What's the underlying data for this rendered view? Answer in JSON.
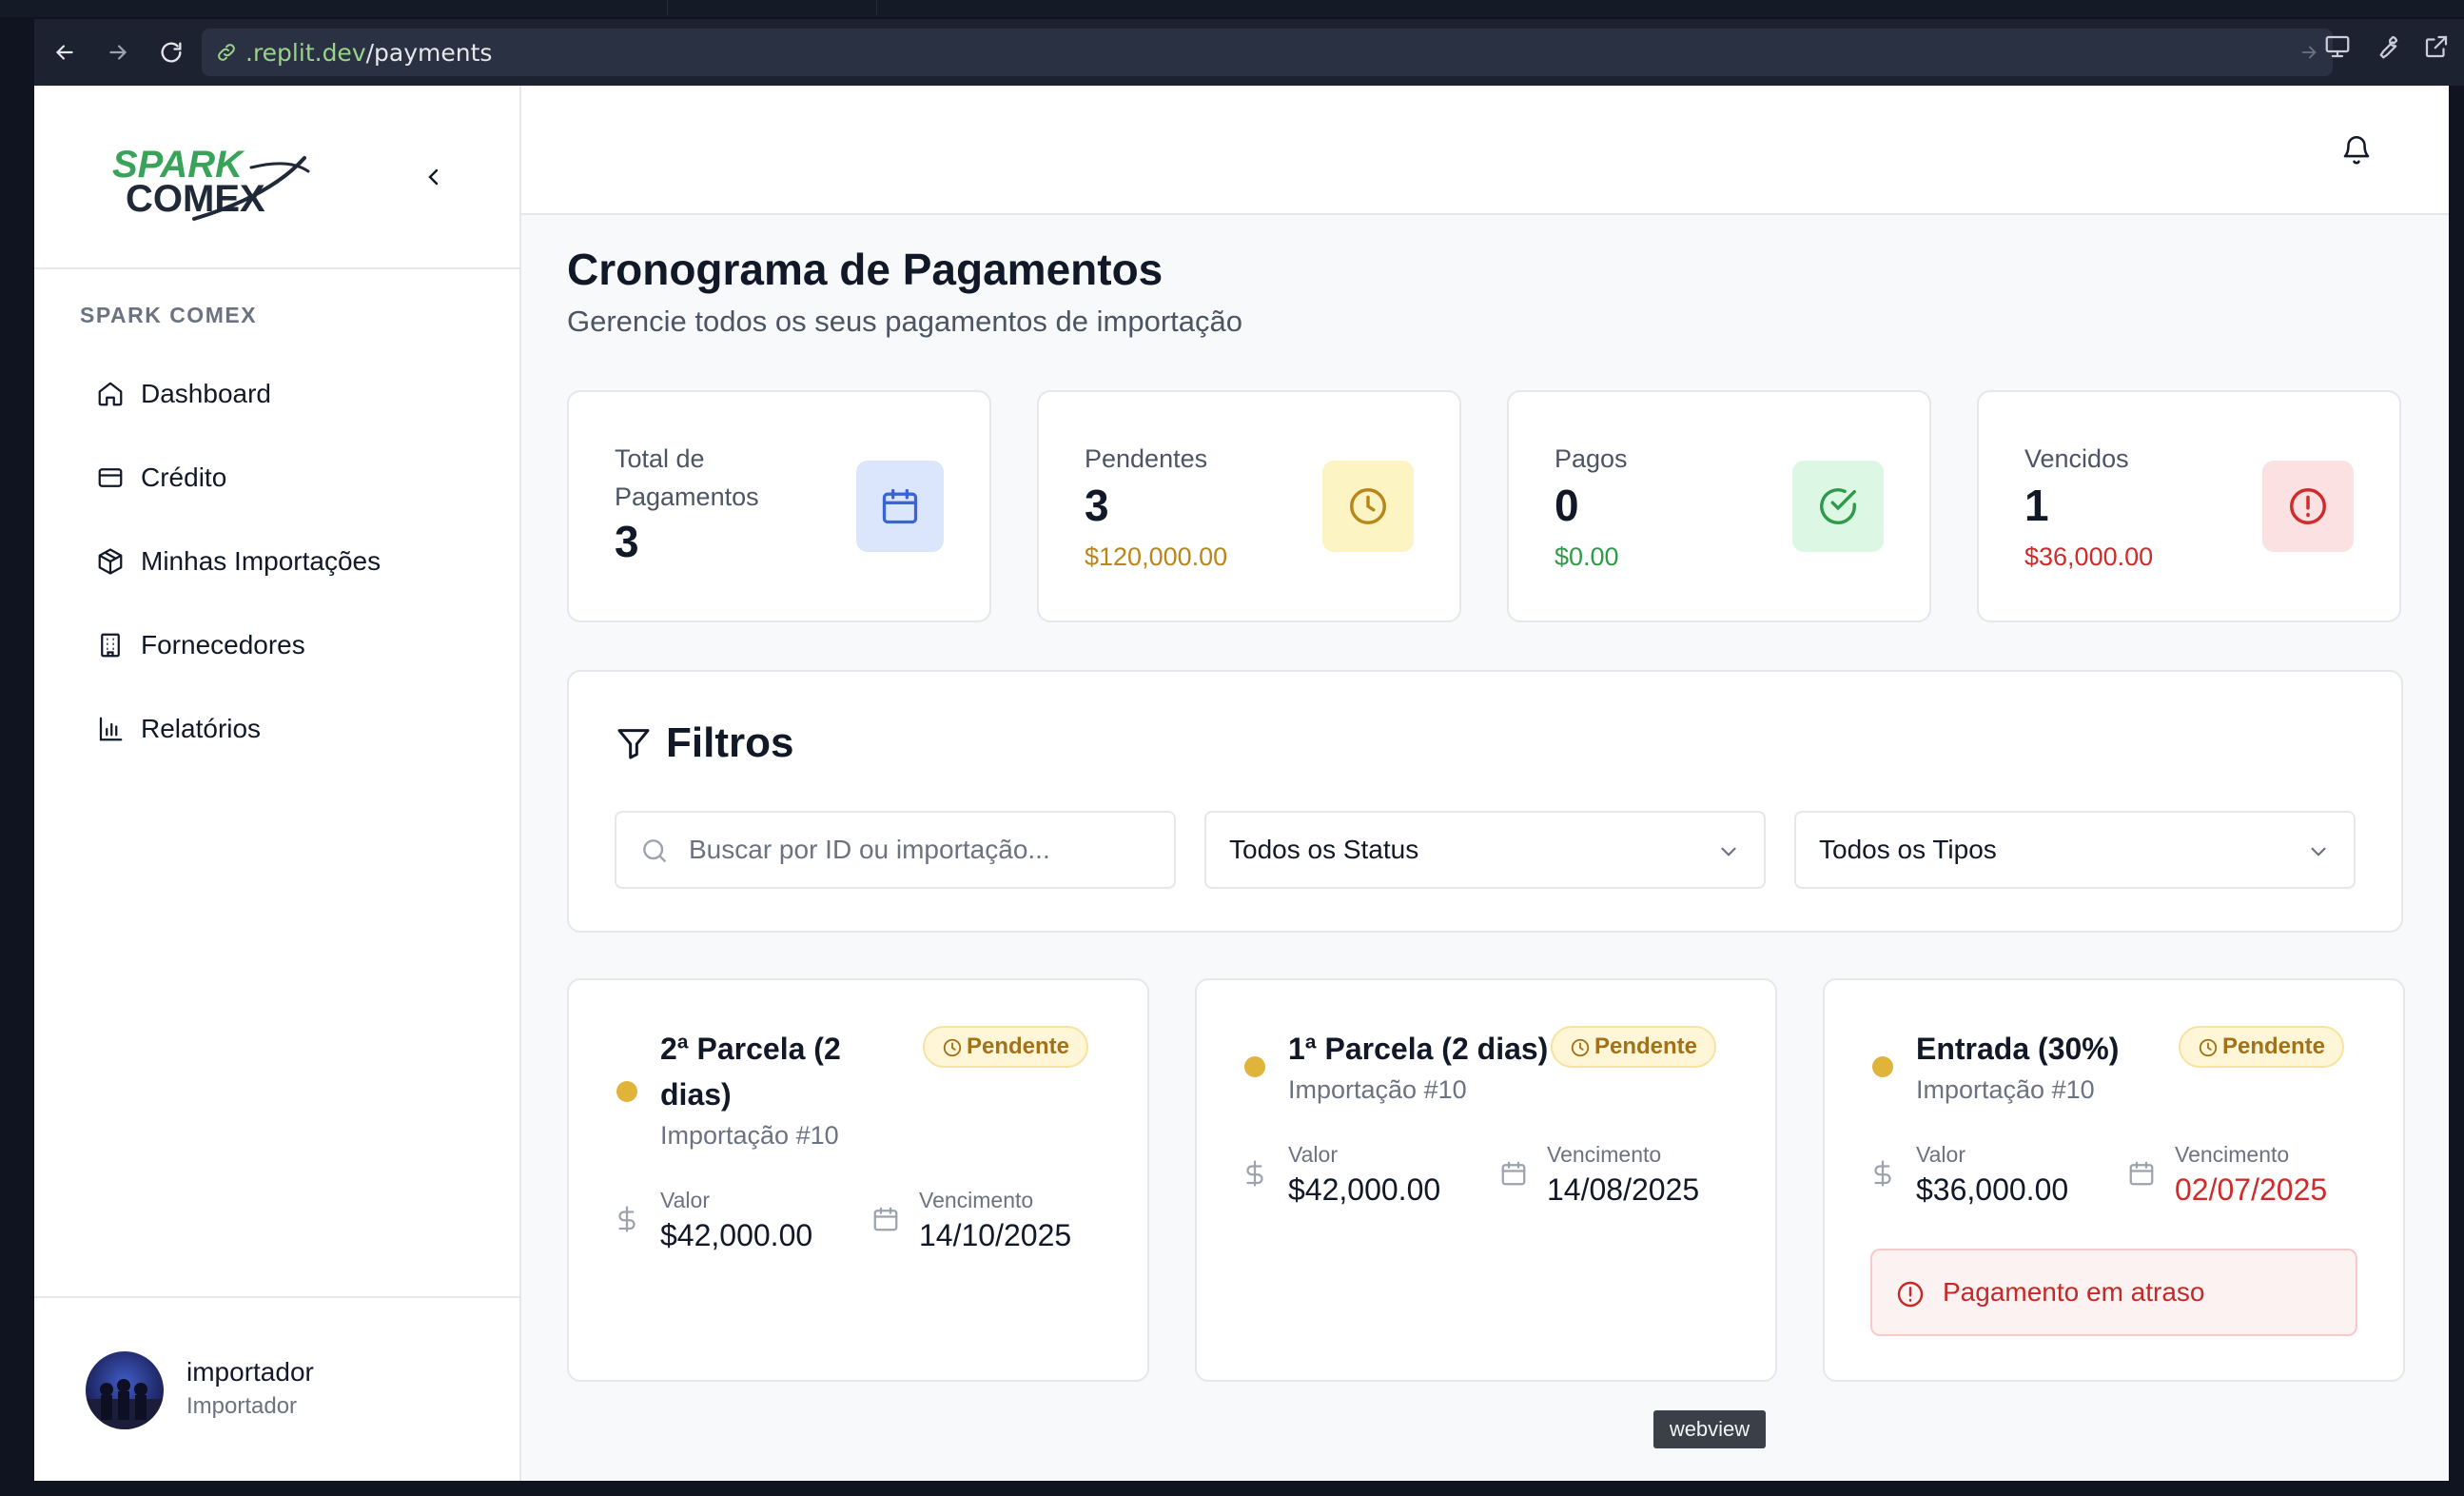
{
  "browser": {
    "url_prefix": ".replit.dev",
    "url_path": "/payments"
  },
  "sidebar": {
    "brand_label": "SPARK COMEX",
    "logo_line1": "SPARK",
    "logo_line2": "COMEX",
    "items": [
      {
        "label": "Dashboard",
        "icon": "home-icon"
      },
      {
        "label": "Crédito",
        "icon": "credit-card-icon"
      },
      {
        "label": "Minhas Importações",
        "icon": "package-icon"
      },
      {
        "label": "Fornecedores",
        "icon": "building-icon"
      },
      {
        "label": "Relatórios",
        "icon": "bar-chart-icon"
      }
    ],
    "user": {
      "name": "importador",
      "role": "Importador"
    }
  },
  "page": {
    "title": "Cronograma de Pagamentos",
    "subtitle": "Gerencie todos os seus pagamentos de importação"
  },
  "stats": [
    {
      "label": "Total de Pagamentos",
      "value": "3",
      "amount": "",
      "icon": "calendar-icon",
      "color": "#3b63d8",
      "bg": "#dbe6fd"
    },
    {
      "label": "Pendentes",
      "value": "3",
      "amount": "$120,000.00",
      "icon": "clock-icon",
      "color": "#b8861a",
      "bg": "#fdf4c3"
    },
    {
      "label": "Pagos",
      "value": "0",
      "amount": "$0.00",
      "icon": "check-circle-icon",
      "color": "#2f9a4a",
      "bg": "#dcf7e3"
    },
    {
      "label": "Vencidos",
      "value": "1",
      "amount": "$36,000.00",
      "icon": "alert-circle-icon",
      "color": "#d02b2b",
      "bg": "#fbe1e1"
    }
  ],
  "filters": {
    "title": "Filtros",
    "search_placeholder": "Buscar por ID ou importação...",
    "status_selected": "Todos os Status",
    "type_selected": "Todos os Tipos"
  },
  "payments": [
    {
      "title_line1": "2ª Parcela (2",
      "title_line2": "dias)",
      "importacao": "Importação #10",
      "status": "Pendente",
      "valor_label": "Valor",
      "valor": "$42,000.00",
      "venc_label": "Vencimento",
      "vencimento": "14/10/2025",
      "overdue": false
    },
    {
      "title_line1": "1ª Parcela (2 dias)",
      "title_line2": "",
      "importacao": "Importação #10",
      "status": "Pendente",
      "valor_label": "Valor",
      "valor": "$42,000.00",
      "venc_label": "Vencimento",
      "vencimento": "14/08/2025",
      "overdue": false
    },
    {
      "title_line1": "Entrada (30%)",
      "title_line2": "",
      "importacao": "Importação #10",
      "status": "Pendente",
      "valor_label": "Valor",
      "valor": "$36,000.00",
      "venc_label": "Vencimento",
      "vencimento": "02/07/2025",
      "overdue": true,
      "overdue_text": "Pagamento em atraso"
    }
  ],
  "tooltip": "webview",
  "colors": {
    "accent_green": "#3aa35a",
    "overdue_red": "#d02b2b",
    "pending_yellow": "#e0b33a"
  }
}
